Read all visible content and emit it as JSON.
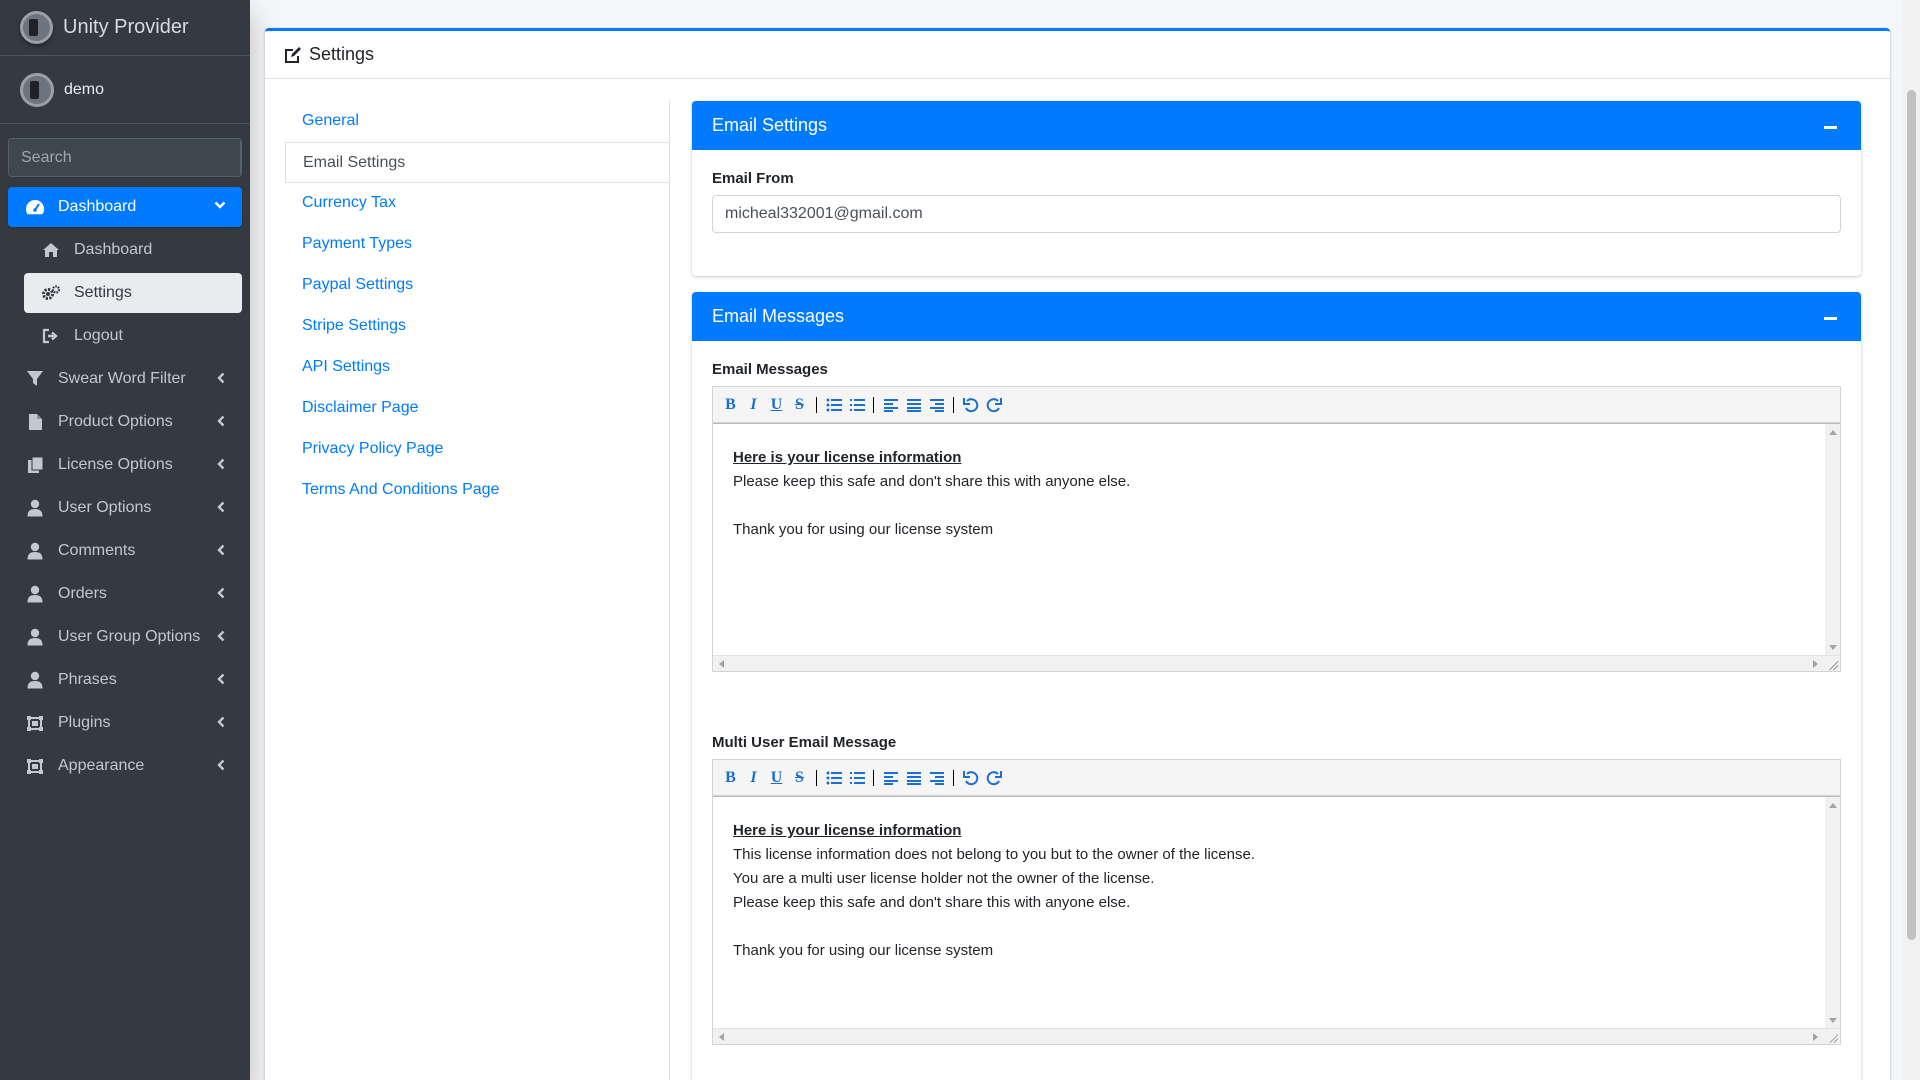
{
  "brand": {
    "name": "Unity Provider"
  },
  "user": {
    "name": "demo"
  },
  "search": {
    "placeholder": "Search"
  },
  "sidebar": {
    "dashboard_group": {
      "label": "Dashboard"
    },
    "sub_items": [
      {
        "label": "Dashboard",
        "icon": "home-icon"
      },
      {
        "label": "Settings",
        "icon": "gears-icon"
      },
      {
        "label": "Logout",
        "icon": "sign-out-icon"
      }
    ],
    "items": [
      {
        "label": "Swear Word Filter",
        "icon": "filter-icon"
      },
      {
        "label": "Product Options",
        "icon": "file-icon"
      },
      {
        "label": "License Options",
        "icon": "copy-icon"
      },
      {
        "label": "User Options",
        "icon": "user-icon"
      },
      {
        "label": "Comments",
        "icon": "user-icon"
      },
      {
        "label": "Orders",
        "icon": "user-icon"
      },
      {
        "label": "User Group Options",
        "icon": "user-icon"
      },
      {
        "label": "Phrases",
        "icon": "user-icon"
      },
      {
        "label": "Plugins",
        "icon": "object-group-icon"
      },
      {
        "label": "Appearance",
        "icon": "object-group-icon"
      }
    ]
  },
  "card": {
    "title": "Settings"
  },
  "settings_menu": [
    "General",
    "Email Settings",
    "Currency Tax",
    "Payment Types",
    "Paypal Settings",
    "Stripe Settings",
    "API Settings",
    "Disclaimer Page",
    "Privacy Policy Page",
    "Terms And Conditions Page"
  ],
  "email_settings": {
    "title": "Email Settings",
    "email_from_label": "Email From",
    "email_from_value": "micheal332001@gmail.com"
  },
  "email_messages": {
    "title": "Email Messages",
    "editor1": {
      "label": "Email Messages",
      "heading": "Here is your license information",
      "lines": [
        "Please keep this safe and don't share this with anyone else.",
        "",
        "Thank you for using our license system"
      ]
    },
    "editor2": {
      "label": "Multi User Email Message",
      "heading": "Here is your license information",
      "lines": [
        "This license information does not belong to you but to the owner of the license.",
        "You are a multi user license holder not the owner of the license.",
        "Please keep this safe and don't share this with anyone else.",
        "",
        "Thank you for using our license system"
      ]
    }
  },
  "colors": {
    "primary": "#007bff",
    "sidebar_bg": "#343a40",
    "link": "#007bff"
  }
}
